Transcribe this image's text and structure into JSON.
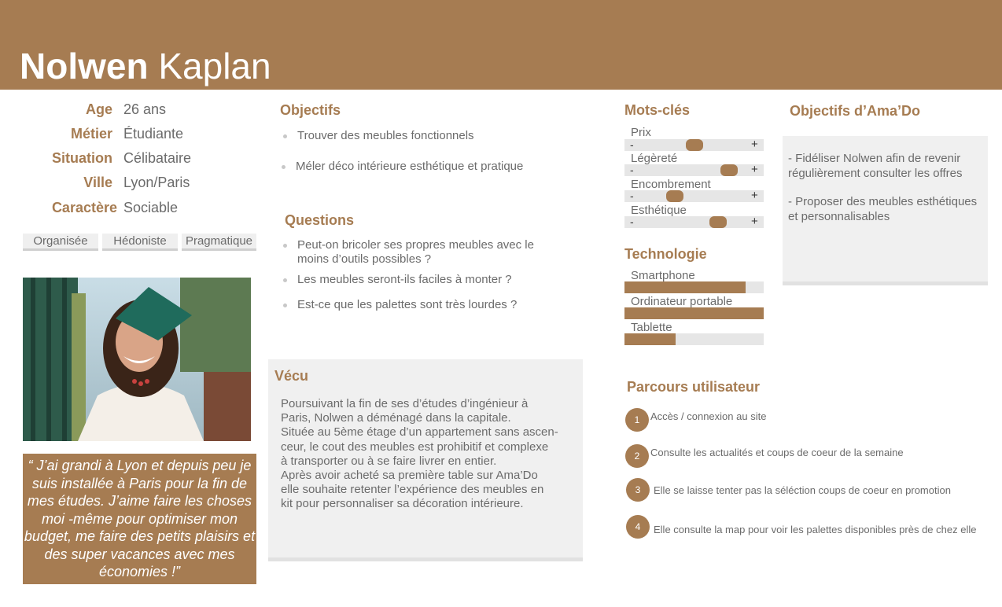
{
  "header": {
    "first_name": "Nolwen",
    "last_name": "Kaplan"
  },
  "profile": {
    "age_label": "Age",
    "age": "26 ans",
    "job_label": "Métier",
    "job": "Étudiante",
    "situation_label": "Situation",
    "situation": "Célibataire",
    "city_label": "Ville",
    "city": "Lyon/Paris",
    "character_label": "Caractère",
    "character": "Sociable"
  },
  "tags": [
    "Organisée",
    "Hédoniste",
    "Pragmatique"
  ],
  "quote": "“ J’ai grandi à Lyon et depuis peu je suis installée à Paris pour la fin de mes études. J’aime faire les choses moi -même pour optimiser mon budget, me faire des petits plaisirs et des super vacances avec mes économies !”",
  "objectifs": {
    "title": "Objectifs",
    "items": [
      "Trouver des meubles fonctionnels",
      "Méler déco intérieure esthétique et pratique"
    ]
  },
  "questions": {
    "title": "Questions",
    "items": [
      "Peut-on bricoler ses propres meubles avec le moins d’outils possibles ?",
      "Les meubles seront-ils faciles à monter ?",
      "Est-ce que les palettes sont très lourdes ?"
    ]
  },
  "vecu": {
    "title": "Vécu",
    "lines": [
      "Poursuivant la fin de ses d’études d’ingénieur à",
      "Paris, Nolwen a déménagé dans la capitale.",
      "Située au 5ème étage d’un appartement sans ascen-",
      "ceur, le cout des meubles est prohibitif et complexe",
      "à transporter ou à se faire livrer en entier.",
      "Après avoir acheté sa première table sur Ama’Do",
      "elle souhaite retenter l’expérience des meubles en",
      "kit pour personnaliser sa décoration intérieure."
    ]
  },
  "keywords": {
    "title": "Mots-clés",
    "minus": "-",
    "plus": "+",
    "items": [
      {
        "label": "Prix",
        "level": 0.5
      },
      {
        "label": "Légèreté",
        "level": 0.75
      },
      {
        "label": "Encombrement",
        "level": 0.36
      },
      {
        "label": "Esthétique",
        "level": 0.67
      }
    ]
  },
  "technologie": {
    "title": "Technologie",
    "items": [
      {
        "label": "Smartphone",
        "level": 0.87
      },
      {
        "label": "Ordinateur portable",
        "level": 1.0
      },
      {
        "label": "Tablette",
        "level": 0.37
      }
    ]
  },
  "amado": {
    "title": "Objectifs d’Ama’Do",
    "items": [
      "- Fidéliser Nolwen afin de revenir régulièrement consulter les offres",
      "- Proposer des meubles esthétiques et personnalisables"
    ]
  },
  "parcours": {
    "title": "Parcours utilisateur",
    "steps": [
      {
        "number": "1",
        "text": "Accès / connexion au site"
      },
      {
        "number": "2",
        "text": "Consulte les actualités et coups de coeur de la semaine"
      },
      {
        "number": "3",
        "text": "Elle se laisse tenter pas la séléction coups de coeur en promotion"
      },
      {
        "number": "4",
        "text": "Elle consulte la map pour voir les palettes disponibles près de chez elle"
      }
    ]
  },
  "colors": {
    "accent": "#a67c52",
    "panel": "#f0f0f0",
    "text": "#6b6b6b"
  }
}
